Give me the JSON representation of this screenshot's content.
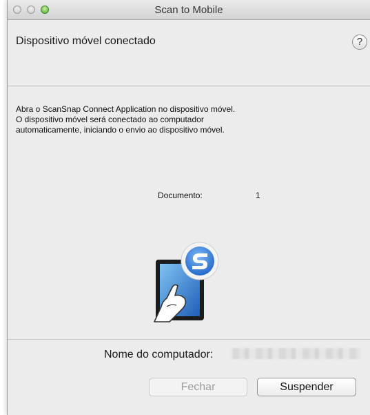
{
  "window": {
    "title": "Scan to Mobile"
  },
  "header": {
    "title": "Dispositivo móvel conectado",
    "help_label": "?"
  },
  "instructions": {
    "line1": "Abra o ScanSnap Connect Application no dispositivo móvel.",
    "line2": "O dispositivo móvel será conectado ao computador",
    "line3": "automaticamente, iniciando o envio ao dispositivo móvel."
  },
  "document": {
    "label": "Documento:",
    "count": "1"
  },
  "footer": {
    "computer_label": "Nome do computador:",
    "close_label": "Fechar",
    "suspend_label": "Suspender"
  },
  "icons": {
    "app_badge": "scansnap-s-icon",
    "device": "tablet-with-hand-icon"
  },
  "colors": {
    "badge_blue": "#2a77d6",
    "tablet_screen": "#3b8ad9"
  }
}
